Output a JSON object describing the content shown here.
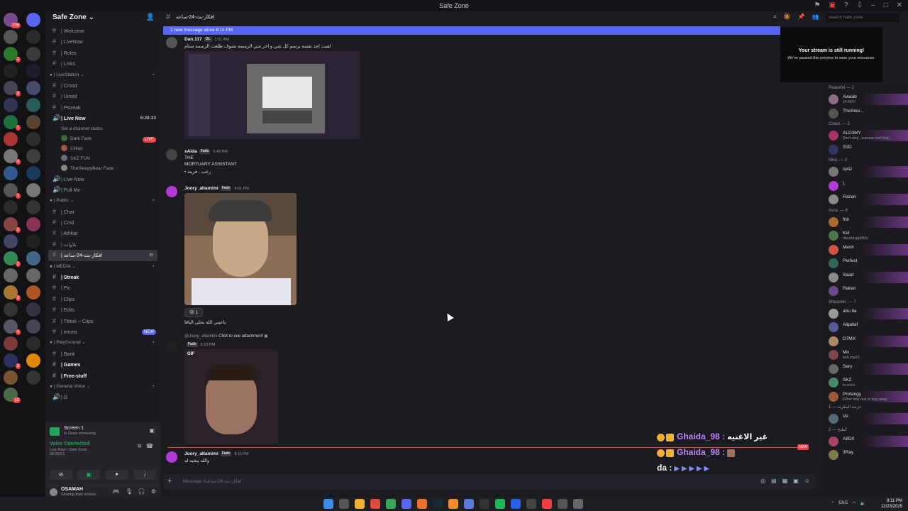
{
  "window": {
    "title": "Safe Zone"
  },
  "server_rail": {
    "badges": [
      "236",
      "2",
      "3",
      "1",
      "4",
      "1",
      "2",
      "2",
      "3",
      "4",
      "3",
      "12",
      "NEW"
    ]
  },
  "guild": {
    "name": "Safe Zone",
    "categories": [
      {
        "name": "LiveStation"
      },
      {
        "name": "Public"
      },
      {
        "name": "MEDIA"
      },
      {
        "name": "PlayGround"
      },
      {
        "name": "General Voice"
      }
    ],
    "channels_top": [
      "Welcome",
      "LiveNow",
      "Roles",
      "Links"
    ],
    "channels_live": [
      "Cmod",
      "Umod",
      "Pstreak"
    ],
    "live_now": {
      "label": "Live Now",
      "time": "6:28:33",
      "status": "Set a channel status"
    },
    "voice_users": [
      {
        "name": "Dark",
        "tag": "Fade"
      },
      {
        "name": "Cillian",
        "tag": ""
      },
      {
        "name": "SKZ",
        "tag": "FUN"
      },
      {
        "name": "TheSleepyBear",
        "tag": "Fade"
      }
    ],
    "live_tag": "LIVE",
    "channels_after": [
      "Live Now",
      "Pull Me"
    ],
    "channels_public": [
      "Chat",
      "Cmd",
      "Athkar",
      "تلاوات"
    ],
    "active_channel": "افكار-بث-24-ساعه",
    "channels_media": [
      "Streak",
      "Pic",
      "Clips",
      "Edits",
      "Tiktok – Clips",
      "emots"
    ],
    "new_tag": "NEW",
    "channels_play": [
      "Bank",
      "Games",
      "Free-stuff"
    ],
    "voice_general": [
      "G"
    ]
  },
  "voice_panel": {
    "screen_title": "Screen 1",
    "screen_sub": "In Deep screening",
    "connected": "Voice Connected",
    "location": "Live Now / Safe Zone",
    "timer": "06:28:51"
  },
  "user": {
    "name": "OSAMAH",
    "status": "Sharing their screen"
  },
  "channel_header": {
    "name": "افكار-بث-24-ساعه"
  },
  "new_messages_bar": "1 new message since 8:11 PM",
  "messages": [
    {
      "user": "Dan.117",
      "tag": "OL",
      "time": "1:51 AM",
      "text": "لقيت احد نفسه يرسم كل شي و اخر شي الرسمه تشوف طلعت الرسمه ستام"
    },
    {
      "user": "xAida",
      "tag": "Fade",
      "time": "6:43 PM",
      "lines": [
        "THE",
        "MORTUARY ASSISTANT",
        "• رعب - فزينة"
      ]
    },
    {
      "user": "Joory_altamimi",
      "tag": "Fade",
      "time": "8:01 PM",
      "reaction_count": "1",
      "text": "ياعيني الله يخلي الباقا"
    },
    {
      "user": "",
      "tag": "Fade",
      "time": "8:10 PM",
      "reply_to": "@Joory_altamimi",
      "reply_text": "Click to see attachment",
      "gif": "GIF"
    },
    {
      "user": "Joory_altamimi",
      "tag": "Fade",
      "time": "8:11 PM",
      "text": "والله يتخبه له"
    }
  ],
  "overlay": {
    "line1_name": "Ghaida_98 :",
    "line1_text": "غير الاغنيه",
    "line2_name": "Ghaida_98 :",
    "line3_text": "da :",
    "new_tag": "NEW"
  },
  "composer": {
    "placeholder": "Message #افكار-بث-24-ساعه"
  },
  "search": {
    "placeholder": "Search Safe Zone"
  },
  "stream_notice": {
    "title": "Your stream is still running!",
    "sub": "We've paused this preview to save your resources."
  },
  "members": [
    {
      "group": "Peaceful — 2",
      "items": [
        {
          "name": "Awaab",
          "sub": "24 NOV"
        },
        {
          "name": "TheSlee...",
          "sub": ""
        }
      ]
    },
    {
      "group": "Cloud. — 2",
      "items": [
        {
          "name": "ALD3MY",
          "sub": "Don't stop , success isn't that..."
        },
        {
          "name": "S3D",
          "sub": ""
        }
      ]
    },
    {
      "group": "Mod. — 3",
      "items": [
        {
          "name": "iq4iz",
          "sub": ""
        },
        {
          "name": "L",
          "sub": ""
        },
        {
          "name": "Razan",
          "sub": ""
        }
      ]
    },
    {
      "group": "Aura. — 6",
      "items": [
        {
          "name": "frtir",
          "sub": ""
        },
        {
          "name": "Kel",
          "sub": "discord.gg/MUU"
        },
        {
          "name": "Mesh",
          "sub": ""
        },
        {
          "name": "Perfect",
          "sub": ""
        },
        {
          "name": "Saad",
          "sub": ""
        },
        {
          "name": "Rakan",
          "sub": ""
        }
      ]
    },
    {
      "group": "Streamer. — 7",
      "items": [
        {
          "name": "abu tla",
          "sub": ""
        },
        {
          "name": "Alqallaf",
          "sub": ""
        },
        {
          "name": "D7MX",
          "sub": ""
        },
        {
          "name": "Mo",
          "sub": "kick.vvp23"
        },
        {
          "name": "Sary",
          "sub": ""
        },
        {
          "name": "SKZ",
          "sub": "In voice"
        },
        {
          "name": "Protangy",
          "sub": "Either stay real or stay away"
        }
      ]
    },
    {
      "group": "حرمة البطرية — 1",
      "items": [
        {
          "name": "IAl",
          "sub": ""
        }
      ]
    },
    {
      "group": "كطبخ — 2",
      "items": [
        {
          "name": "A8D0",
          "sub": ""
        },
        {
          "name": "3Ray",
          "sub": ""
        }
      ]
    }
  ],
  "taskbar": {
    "lang": "ENG",
    "time": "8:11 PM",
    "date": "12/23/2025"
  },
  "colors": {
    "accent": "#5865f2",
    "live": "#f23f43",
    "online": "#23a55a",
    "overlay_name": "#c084fc"
  }
}
